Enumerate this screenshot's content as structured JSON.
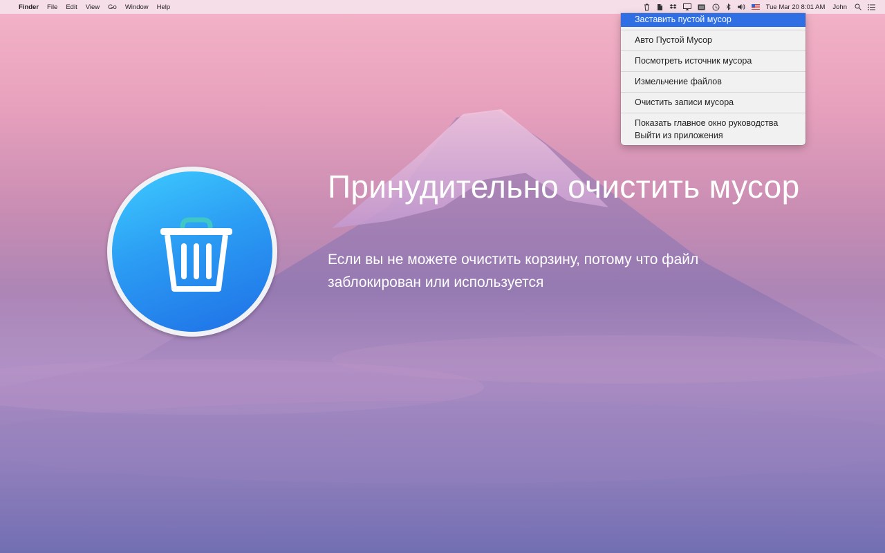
{
  "menubar": {
    "app_name": "Finder",
    "menus": [
      "File",
      "Edit",
      "View",
      "Go",
      "Window",
      "Help"
    ],
    "clock": "Tue Mar 20  8:01 AM",
    "user": "John",
    "tray_icons": [
      "trash-icon",
      "evernote-icon",
      "dropbox-icon",
      "airplay-icon",
      "battery-icon",
      "time-machine-icon",
      "bluetooth-icon",
      "volume-icon",
      "flag-icon",
      "wifi-icon"
    ]
  },
  "dropdown": {
    "items": [
      "Заставить пустой мусор",
      "Авто Пустой Мусор",
      "Посмотреть источник мусора",
      "Измельчение файлов",
      "Очистить записи мусора",
      "Показать главное окно руководства",
      "Выйти из приложения"
    ],
    "selected_index": 0
  },
  "hero": {
    "headline": "Принудительно очистить мусор",
    "subtext_line1": "Если вы не можете очистить корзину, потому что файл",
    "subtext_line2": "заблокирован или используется"
  },
  "colors": {
    "accent_selection": "#2f6fe3",
    "badge_gradient_top": "#3ecbff",
    "badge_gradient_bottom": "#1f6fe6"
  }
}
